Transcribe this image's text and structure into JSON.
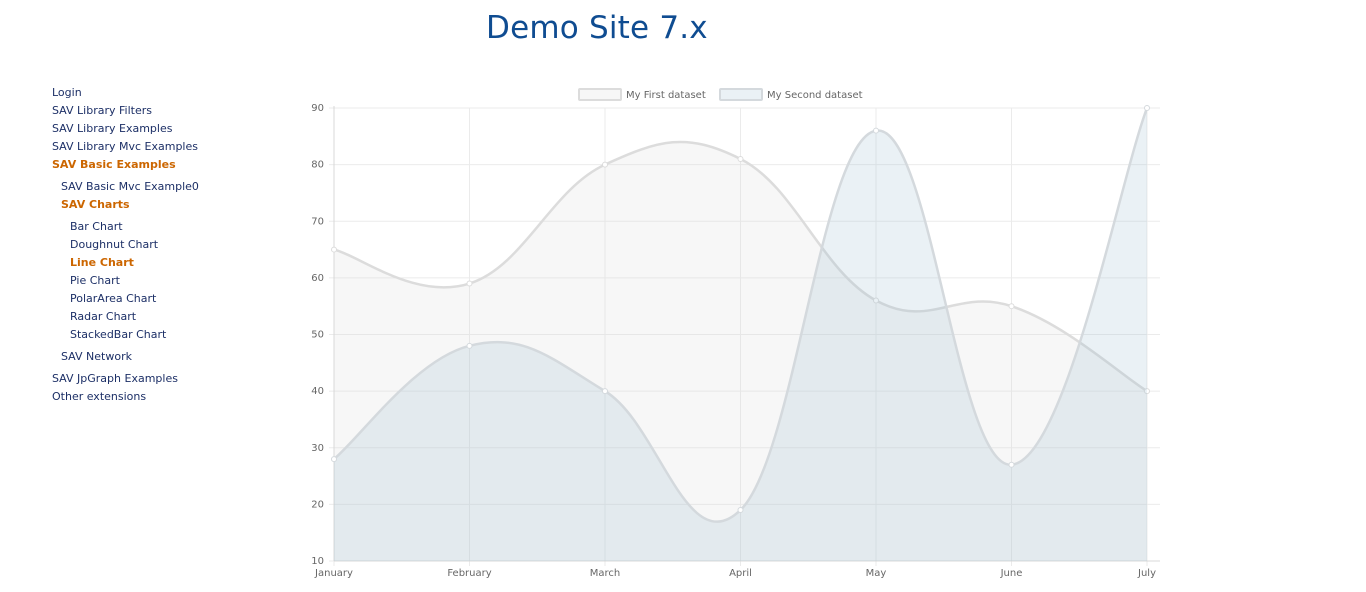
{
  "header": {
    "title": "Demo Site 7.x"
  },
  "nav": {
    "items": [
      {
        "label": "Login",
        "level": 0,
        "active": false
      },
      {
        "label": "SAV Library Filters",
        "level": 0,
        "active": false
      },
      {
        "label": "SAV Library Examples",
        "level": 0,
        "active": false
      },
      {
        "label": "SAV Library Mvc Examples",
        "level": 0,
        "active": false
      },
      {
        "label": "SAV Basic Examples",
        "level": 0,
        "active": true
      },
      {
        "label": "SAV Basic Mvc Example0",
        "level": 1,
        "active": false
      },
      {
        "label": "SAV Charts",
        "level": 1,
        "active": true
      },
      {
        "label": "Bar Chart",
        "level": 2,
        "active": false
      },
      {
        "label": "Doughnut Chart",
        "level": 2,
        "active": false
      },
      {
        "label": "Line Chart",
        "level": 2,
        "active": true
      },
      {
        "label": "Pie Chart",
        "level": 2,
        "active": false
      },
      {
        "label": "PolarArea Chart",
        "level": 2,
        "active": false
      },
      {
        "label": "Radar Chart",
        "level": 2,
        "active": false
      },
      {
        "label": "StackedBar Chart",
        "level": 2,
        "active": false
      },
      {
        "label": "SAV Network",
        "level": 1,
        "active": false
      },
      {
        "label": "SAV JpGraph Examples",
        "level": 0,
        "active": false
      },
      {
        "label": "Other extensions",
        "level": 0,
        "active": false
      }
    ]
  },
  "colors": {
    "title": "#0f4c91",
    "nav_text": "#1c2f66",
    "nav_active": "#cc6600",
    "series1_fill": "rgba(220,220,220,0.22)",
    "series1_stroke": "#dcdcdc",
    "series2_fill": "rgba(151,187,205,0.2)",
    "series2_stroke": "#d4d9dd"
  },
  "chart_data": {
    "type": "line",
    "style": "smoothed-area",
    "categories": [
      "January",
      "February",
      "March",
      "April",
      "May",
      "June",
      "July"
    ],
    "series": [
      {
        "name": "My First dataset",
        "values": [
          65,
          59,
          80,
          81,
          56,
          55,
          40
        ]
      },
      {
        "name": "My Second dataset",
        "values": [
          28,
          48,
          40,
          19,
          86,
          27,
          90
        ]
      }
    ],
    "yticks": [
      10,
      20,
      30,
      40,
      50,
      60,
      70,
      80,
      90
    ],
    "ylim": [
      10,
      90
    ],
    "grid": true,
    "legend": "top-center"
  }
}
